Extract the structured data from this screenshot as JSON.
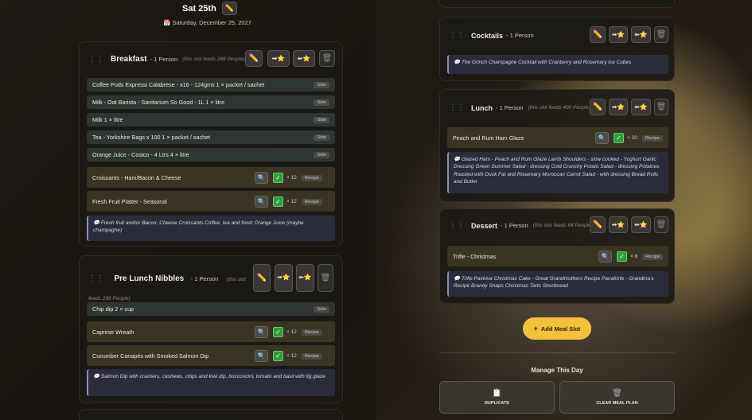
{
  "day": {
    "short": "Sat 25th",
    "long": "Saturday, December 25, 2027",
    "calendar_icon": "📅"
  },
  "icons": {
    "edit": "✏️",
    "move_next": "➡⭐",
    "move_prev": "⬅⭐",
    "trash": "🗑",
    "search": "🔍",
    "check": "✓",
    "drag": "⋮⋮",
    "note": "💬",
    "plus": "+"
  },
  "slots": {
    "breakfast": {
      "name": "Breakfast",
      "count": "- 1 Person",
      "feeds": "(this slot feeds 288 People)",
      "sides": [
        {
          "name": "Coffee Pods Expressi Calabrese - x16 - 124gms 1 × packet / sachet",
          "tag": "Side"
        },
        {
          "name": "Milk - Oat Barista - Sanitarium So Good - 1L 1 × litre",
          "tag": "Side"
        },
        {
          "name": "Milk 1 × litre",
          "tag": "Side"
        },
        {
          "name": "Tea - Yorkshire Bags x 100 1 × packet / sachet",
          "tag": "Side"
        },
        {
          "name": "Orange Juice - Costco - 4 Ltrs 4 × litre",
          "tag": "Side"
        }
      ],
      "recipes": [
        {
          "name": "Croissants - Ham/Bacon & Cheese",
          "qty": "× 12",
          "tag": "Recipe"
        },
        {
          "name": "Fresh Fruit Platter - Seasonal",
          "qty": "× 12",
          "tag": "Recipe"
        }
      ],
      "note": "Fresh fruit and/or Bacon, Cheese Croissants Coffee, tea and fresh Orange Juice (maybe champagne)"
    },
    "pre_lunch": {
      "name": "Pre Lunch Nibbles",
      "count": "- 1 Person",
      "feeds": "(this slot feeds 288 People)",
      "sides": [
        {
          "name": "Chip dip 2 × cup",
          "tag": "Side"
        }
      ],
      "recipes": [
        {
          "name": "Caprese Wreath",
          "qty": "× 12",
          "tag": "Recipe"
        },
        {
          "name": "Cucumber Canapés with Smoked Salmon Dip",
          "qty": "× 12",
          "tag": "Recipe"
        }
      ],
      "note": "Salmon Dip with crackers, cashews, chips and kiwi dip, bocconcini, tomato and basil with fig glaze"
    },
    "cocktails": {
      "name": "Cocktails",
      "count": "- 1 Person",
      "note": "The Grinch Champagne Cocktail with Cranberry and Rosemary Ice Cubes"
    },
    "lunch": {
      "name": "Lunch",
      "count": "- 1 Person",
      "feeds": "(this slot feeds 400 People)",
      "recipes": [
        {
          "name": "Peach and Rum Ham Glaze",
          "qty": "× 20",
          "tag": "Recipe"
        }
      ],
      "note": "Glazed Ham - Peach and Rum Glaze Lamb Shoulders - slow cooked - Yoghurt Garlic Dressing Green Summer Salad - dressing Cold Crunchy Potato Salad - dressing Potatoes Roasted with Duck Fat and Rosemary Moroccan Carrot Salad - with dressing Bread Rolls and Butter"
    },
    "dessert": {
      "name": "Dessert",
      "count": "- 1 Person",
      "feeds": "(this slot feeds 64 People)",
      "recipes": [
        {
          "name": "Trifle - Christmas",
          "qty": "× 8",
          "tag": "Recipe"
        }
      ],
      "note": "Trifle Pavlova Christmas Cake - Great Grandmothers Recipe Panaforte - Grandma's Recipe Brandy Snaps Christmas Tarts Shortbread"
    }
  },
  "add_slot": "Add Meal Slot",
  "manage": {
    "title": "Manage This Day",
    "duplicate": "DUPLICATE",
    "clear": "CLEAR MEAL PLAN",
    "dup_icon": "📋",
    "clear_icon": "🗑"
  }
}
